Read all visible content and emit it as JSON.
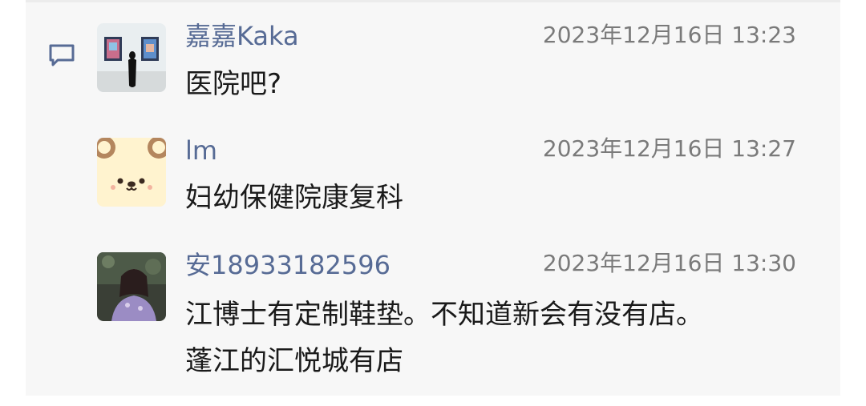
{
  "comments": [
    {
      "author": "嘉嘉Kaka",
      "time": "2023年12月16日 13:23",
      "text_lines": [
        "医院吧?"
      ],
      "avatar": "gallery-photo-avatar"
    },
    {
      "author": "lm",
      "time": "2023年12月16日 13:27",
      "text_lines": [
        "妇幼保健院康复科"
      ],
      "avatar": "bear-face-avatar"
    },
    {
      "author": "安18933182596",
      "time": "2023年12月16日 13:30",
      "text_lines": [
        "江博士有定制鞋垫。不知道新会有没有店。",
        "蓬江的汇悦城有店"
      ],
      "avatar": "portrait-photo-avatar"
    }
  ],
  "colors": {
    "author": "#576b95",
    "time": "#7a7a7a",
    "text": "#1a1a1a",
    "panel": "#f7f7f7"
  },
  "icons": {
    "comments_section": "comment-bubble-icon"
  }
}
